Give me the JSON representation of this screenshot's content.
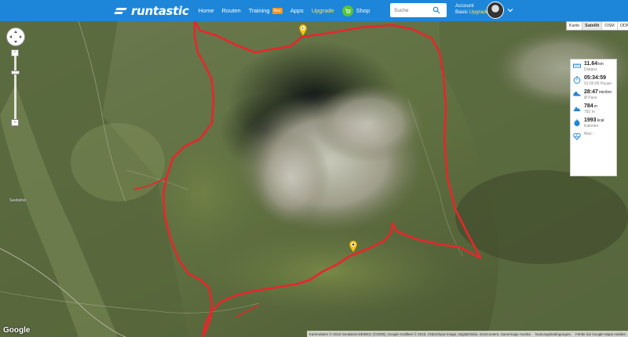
{
  "header": {
    "logo_text": "runtastic",
    "nav": [
      {
        "label": "Home"
      },
      {
        "label": "Routen"
      },
      {
        "label": "Training",
        "badge": "Neu"
      },
      {
        "label": "Apps"
      },
      {
        "label": "Upgrade",
        "highlight": true
      }
    ],
    "shop_label": "Shop",
    "search_placeholder": "Suche",
    "account_label": "Account",
    "account_type": "Basic",
    "account_upgrade": "Upgrade",
    "brand_color": "#1d86d9"
  },
  "map": {
    "map_types": [
      "Karte",
      "Satellit",
      "OSM",
      "ODM"
    ],
    "active_map_type": "Satellit",
    "route_color": "#e8262b",
    "place_labels": [
      "Seebühel"
    ],
    "google_logo": "Google",
    "attribution": "Kartendaten © 2015 GeoBasis-DE/BKG (©2009), Google Grafiken © 2015, CNES/Spot Image, DigitalGlobe, GeoContent, Sanermage Austria",
    "terms": "Nutzungsbedingungen",
    "report": "Fehler bei Google Maps melden"
  },
  "stats": {
    "distance": {
      "value": "11.64",
      "unit": "km",
      "label": "Distanz",
      "icon": "ruler-icon"
    },
    "duration": {
      "value": "05:34:59",
      "unit": "",
      "label": "01:00:00 Pause",
      "icon": "stopwatch-icon"
    },
    "pace": {
      "value": "28:47",
      "unit": "min/km",
      "label": "Ø Pace",
      "icon": "shoe-icon"
    },
    "elevation": {
      "value": "784",
      "unit": "m",
      "label": "782 m",
      "icon": "mountain-icon"
    },
    "calories": {
      "value": "1993",
      "unit": "kcal",
      "label": "Kalorien",
      "icon": "flame-icon"
    },
    "heart": {
      "value": "",
      "unit": "",
      "label": "Max: -",
      "icon": "heart-rate-icon"
    }
  }
}
